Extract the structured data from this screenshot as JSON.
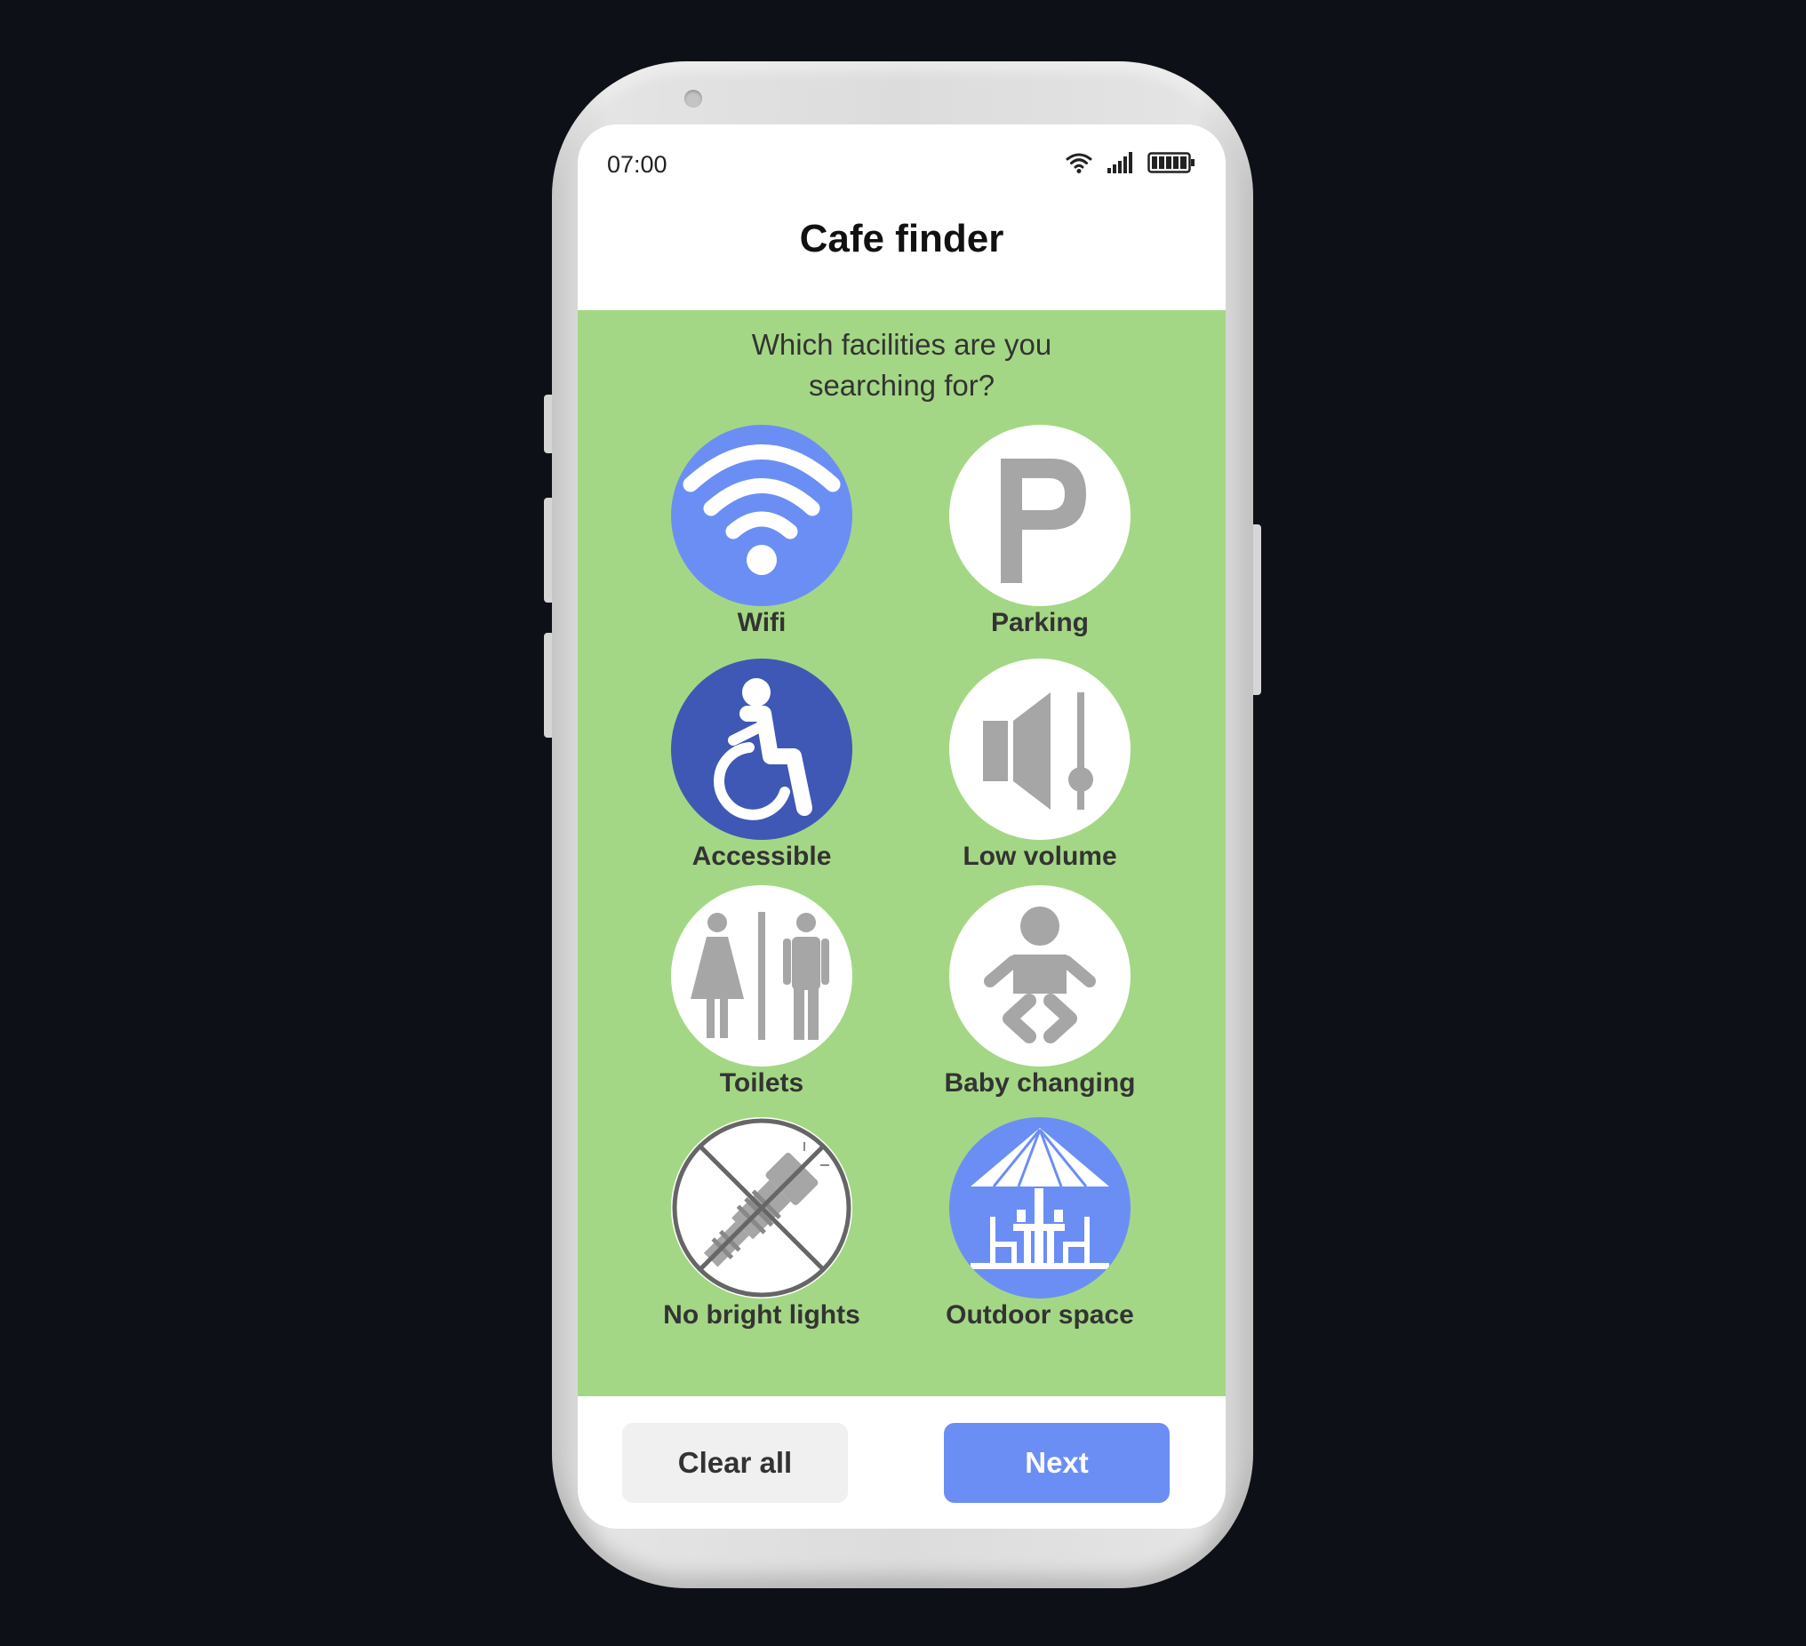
{
  "status_bar": {
    "time": "07:00",
    "icons": [
      "wifi-icon",
      "signal-icon",
      "battery-icon"
    ]
  },
  "app": {
    "title": "Cafe finder"
  },
  "question": {
    "line1": "Which facilities are you",
    "line2": "searching for?"
  },
  "facilities": [
    {
      "label": "Wifi",
      "icon": "wifi-icon",
      "selected": true,
      "color": "#6b8ef5"
    },
    {
      "label": "Parking",
      "icon": "parking-icon",
      "selected": false,
      "color": "#ffffff"
    },
    {
      "label": "Accessible",
      "icon": "wheelchair-icon",
      "selected": true,
      "color": "#3f58b5"
    },
    {
      "label": "Low volume",
      "icon": "speaker-volume-icon",
      "selected": false,
      "color": "#ffffff"
    },
    {
      "label": "Toilets",
      "icon": "toilets-icon",
      "selected": false,
      "color": "#ffffff"
    },
    {
      "label": "Baby changing",
      "icon": "baby-icon",
      "selected": false,
      "color": "#ffffff"
    },
    {
      "label": "No bright lights",
      "icon": "no-flashlight-icon",
      "selected": false,
      "color": "#ffffff"
    },
    {
      "label": "Outdoor space",
      "icon": "outdoor-umbrella-table-icon",
      "selected": true,
      "color": "#6b8ef5"
    }
  ],
  "buttons": {
    "clear_label": "Clear all",
    "next_label": "Next"
  },
  "colors": {
    "background": "#0d1016",
    "content_green": "#a4d785",
    "accent_blue": "#6b8ef5",
    "dark_blue": "#3f58b5",
    "icon_gray": "#a6a6a6"
  }
}
